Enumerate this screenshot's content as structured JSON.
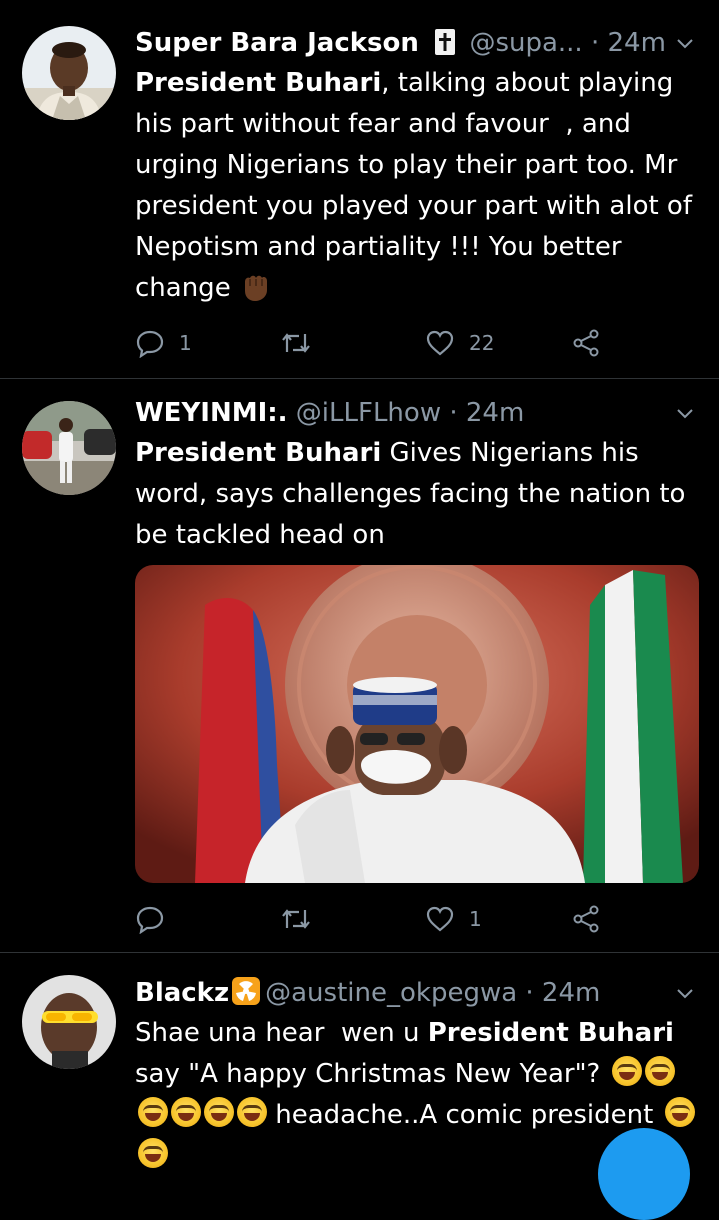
{
  "tweets": [
    {
      "name": "Super Bara Jackson",
      "handle": "@supa...",
      "time": "· 24m",
      "text_parts": {
        "bold1": "President Buhari",
        "rest1": ", talking about playing his part without fear and favour  , and urging Nigerians to play their part too. Mr president you played your part with alot of Nepotism and partiality !!! You better change "
      },
      "emoji_icon": "raised-fist-icon",
      "actions": {
        "reply": "1",
        "retweet": "",
        "like": "22"
      }
    },
    {
      "name": "WEYINMI:.",
      "handle": "@iLLFLhow",
      "time": "· 24m",
      "text_parts": {
        "bold1": "President Buhari",
        "rest1": " Gives Nigerians his word, says challenges facing the nation to be tackled head on"
      },
      "media_alt": "photo",
      "actions": {
        "reply": "",
        "retweet": "",
        "like": "1"
      }
    },
    {
      "name": "Blackz",
      "name_emoji": "radioactive-icon",
      "handle": "@austine_okpegwa",
      "time": "· 24m",
      "text_parts": {
        "pre": "Shae una hear  wen u ",
        "bold1": "President Buhari",
        "rest1": " say \"A happy Christmas New Year\"? ",
        "rest2": " headache..A comic president"
      }
    }
  ],
  "colors": {
    "background": "#000000",
    "text": "#ffffff",
    "secondary": "#8b98a5",
    "accent": "#1d9bf0",
    "divider": "#2f3336"
  },
  "fab_icon": "compose-button"
}
